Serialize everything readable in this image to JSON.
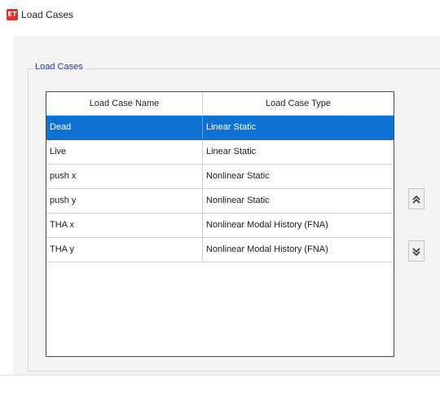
{
  "window": {
    "icon": "etabs-app-icon",
    "icon_text": "ET",
    "title": "Load Cases"
  },
  "group": {
    "label": "Load Cases"
  },
  "table": {
    "columns": [
      "Load Case Name",
      "Load Case Type"
    ],
    "rows": [
      {
        "name": "Dead",
        "type": "Linear Static",
        "selected": true
      },
      {
        "name": "Live",
        "type": "Linear Static",
        "selected": false
      },
      {
        "name": "push x",
        "type": "Nonlinear Static",
        "selected": false
      },
      {
        "name": "push y",
        "type": "Nonlinear Static",
        "selected": false
      },
      {
        "name": "THA x",
        "type": "Nonlinear Modal History (FNA)",
        "selected": false
      },
      {
        "name": "THA y",
        "type": "Nonlinear Modal History (FNA)",
        "selected": false
      }
    ]
  },
  "buttons": {
    "move_up": {
      "icon": "double-chevron-up-icon",
      "glyph": "«"
    },
    "move_down": {
      "icon": "double-chevron-down-icon",
      "glyph": "»"
    }
  },
  "colors": {
    "selection": "#0e72d2",
    "app_icon": "#d9342b",
    "group_label": "#1f3a8a"
  }
}
